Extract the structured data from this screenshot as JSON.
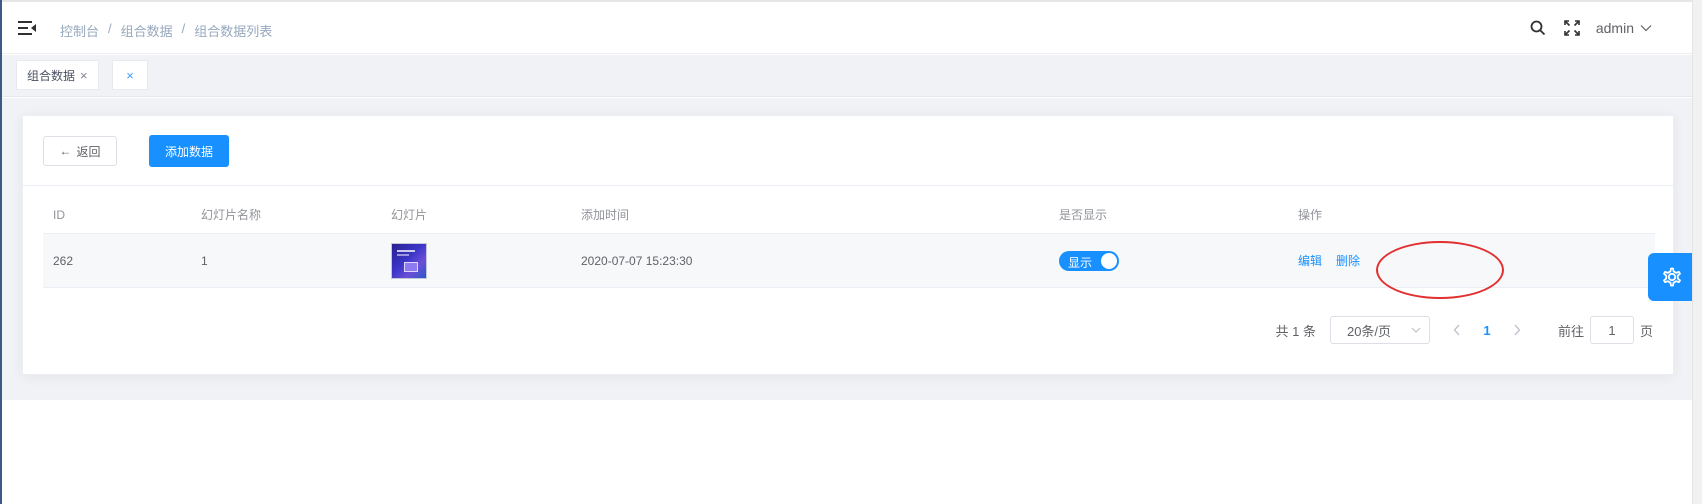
{
  "header": {
    "breadcrumb": [
      "控制台",
      "组合数据",
      "组合数据列表"
    ],
    "breadcrumb_sep": "/",
    "user_name": "admin"
  },
  "tags": {
    "active_label": "组合数据",
    "close_glyph": "×"
  },
  "toolbar": {
    "back_arrow": "←",
    "back_label": "返回",
    "add_label": "添加数据"
  },
  "table": {
    "columns": [
      "ID",
      "幻灯片名称",
      "幻灯片",
      "添加时间",
      "是否显示",
      "操作"
    ],
    "rows": [
      {
        "id": "262",
        "name": "1",
        "image_icon": "slide-thumbnail",
        "created": "2020-07-07 15:23:30",
        "show_label": "显示",
        "show_state": true,
        "edit_label": "编辑",
        "delete_label": "删除"
      }
    ]
  },
  "pagination": {
    "total_text": "共 1 条",
    "page_size": "20条/页",
    "current_page": "1",
    "goto_label": "前往",
    "goto_value": "1",
    "page_suffix": "页"
  },
  "colors": {
    "primary": "#1890ff",
    "annotation": "#e22f2f",
    "sidebar_edge": "#3d5a86"
  }
}
